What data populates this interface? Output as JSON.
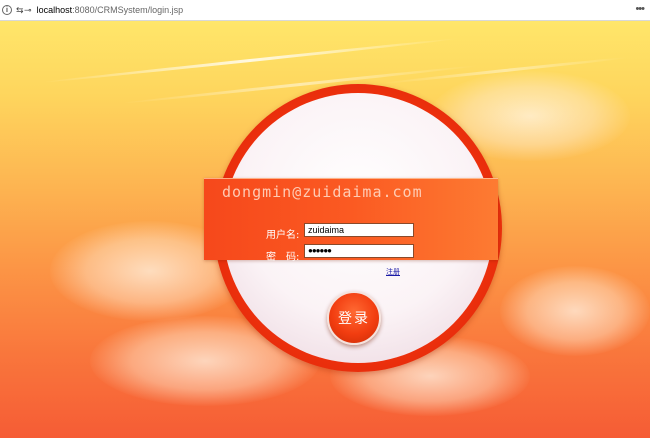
{
  "browser": {
    "url_host": "localhost",
    "url_path": ":8080/CRMSystem/login.jsp",
    "info_icon": "info-icon",
    "site_settings_icon": "tune-icon",
    "more_icon": "more-icon"
  },
  "login": {
    "watermark": "dongmin@zuidaima.com",
    "username_label": "用户名:",
    "username_value": "zuidaima",
    "password_label": "密　码:",
    "password_value": "●●●●●●",
    "register_link": "注册",
    "login_button": "登录"
  },
  "colors": {
    "sky_top": "#ffe66a",
    "sky_bottom": "#f65c35",
    "ring": "#f0310d",
    "band": "#fb5a22",
    "button": "#f23d10"
  }
}
